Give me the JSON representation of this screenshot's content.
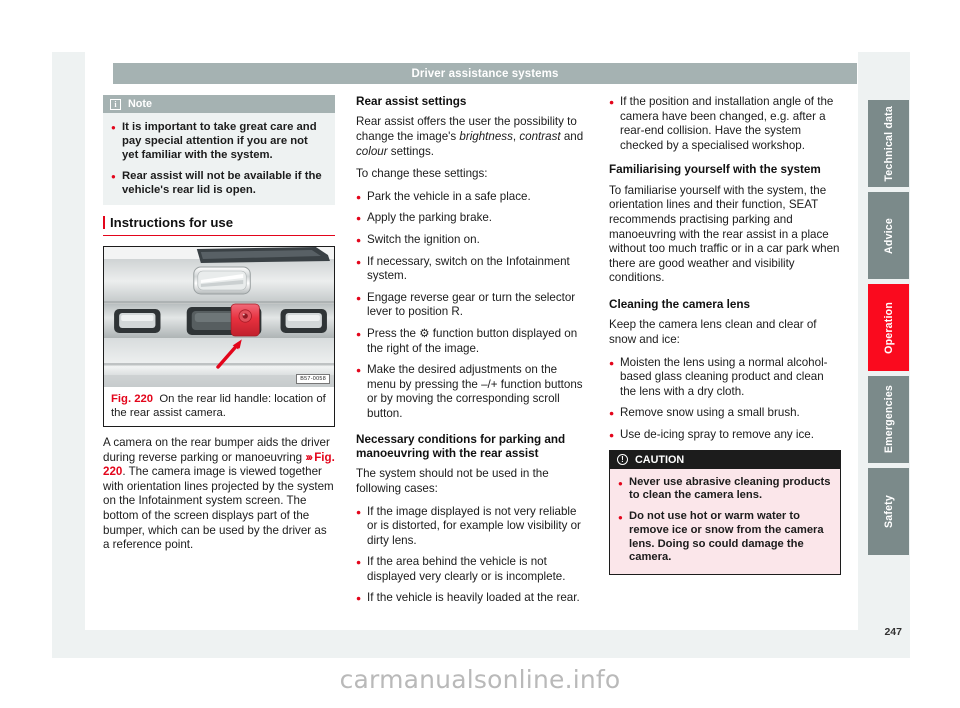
{
  "header": {
    "title": "Driver assistance systems"
  },
  "note": {
    "icon": "info-icon",
    "icon_glyph": "i",
    "label": "Note",
    "items": [
      "It is important to take great care and pay special attention if you are not yet familiar with the system.",
      "Rear assist will not be available if the vehicle's rear lid is open."
    ]
  },
  "section": {
    "instructions_title": "Instructions for use"
  },
  "figure": {
    "number": "Fig. 220",
    "caption": "On the rear lid handle: location of the rear assist camera.",
    "code": "B57-0058",
    "alt": "Rear lid handle with rear assist camera highlighted in red and a red arrow pointing at it"
  },
  "column1": {
    "body_parts": {
      "p1a": "A camera on the rear bumper aids the driver during reverse parking or manoeuvring ",
      "ref_chev": "›››",
      "ref_fig": "Fig. 220",
      "p1b": ". The camera image is viewed together with orientation lines projected by the system on the Infotainment system screen. The bottom of the screen displays part of the bumper, which can be used by the driver as a reference point."
    }
  },
  "column2": {
    "heading_rear_assist_settings": "Rear assist settings",
    "intro_a": "Rear assist offers the user the possibility to change the image's ",
    "intro_i1": "brightness",
    "intro_b": ", ",
    "intro_i2": "contrast",
    "intro_c": " and ",
    "intro_i3": "colour",
    "intro_d": " settings.",
    "to_change": "To change these settings:",
    "steps": [
      "Park the vehicle in a safe place.",
      "Apply the parking brake.",
      "Switch the ignition on.",
      "If necessary, switch on the Infotainment system.",
      "Engage reverse gear or turn the selector lever to position R.",
      "Press the ⚙ function button displayed on the right of the image.",
      "Make the desired adjustments on the menu by pressing the –/+ function buttons or by moving the corresponding scroll button."
    ],
    "heading_necessary": "Necessary conditions for parking and manoeuvring with the rear assist",
    "necessary_intro": "The system should not be used in the following cases:",
    "necessary_items": [
      "If the image displayed is not very reliable or is distorted, for example low visibility or dirty lens.",
      "If the area behind the vehicle is not displayed very clearly or is incomplete.",
      "If the vehicle is heavily loaded at the rear."
    ]
  },
  "column3": {
    "first_bullet": "If the position and installation angle of the camera have been changed, e.g. after a rear-end collision. Have the system checked by a specialised workshop.",
    "heading_familiarising": "Familiarising yourself with the system",
    "familiarising_text": "To familiarise yourself with the system, the orientation lines and their function, SEAT recommends practising parking and manoeuvring with the rear assist in a place without too much traffic or in a car park when there are good weather and visibility conditions.",
    "heading_cleaning": "Cleaning the camera lens",
    "cleaning_intro": "Keep the camera lens clean and clear of snow and ice:",
    "cleaning_items": [
      "Moisten the lens using a normal alcohol-based glass cleaning product and clean the lens with a dry cloth.",
      "Remove snow using a small brush.",
      "Use de-icing spray to remove any ice."
    ],
    "caution": {
      "icon": "exclamation-circle-icon",
      "icon_glyph": "!",
      "label": "CAUTION",
      "items": [
        "Never use abrasive cleaning products to clean the camera lens.",
        "Do not use hot or warm water to remove ice or snow from the camera lens. Doing so could damage the camera."
      ]
    }
  },
  "side_tabs": [
    {
      "label": "Technical data",
      "active": false,
      "height": 87
    },
    {
      "label": "Advice",
      "active": false,
      "height": 87
    },
    {
      "label": "Operation",
      "active": true,
      "height": 87
    },
    {
      "label": "Emergencies",
      "active": false,
      "height": 87
    },
    {
      "label": "Safety",
      "active": false,
      "height": 87
    }
  ],
  "footer": {
    "page_number": "247",
    "watermark": "carmanualsonline.info"
  },
  "colors": {
    "accent_red": "#e3051b",
    "tab_active_red": "#fa0a1e",
    "header_gray": "#a5b2b2",
    "panel_gray": "#eef2f2",
    "tab_gray": "#7b8a8a",
    "caution_pink": "#fbe6ea"
  }
}
